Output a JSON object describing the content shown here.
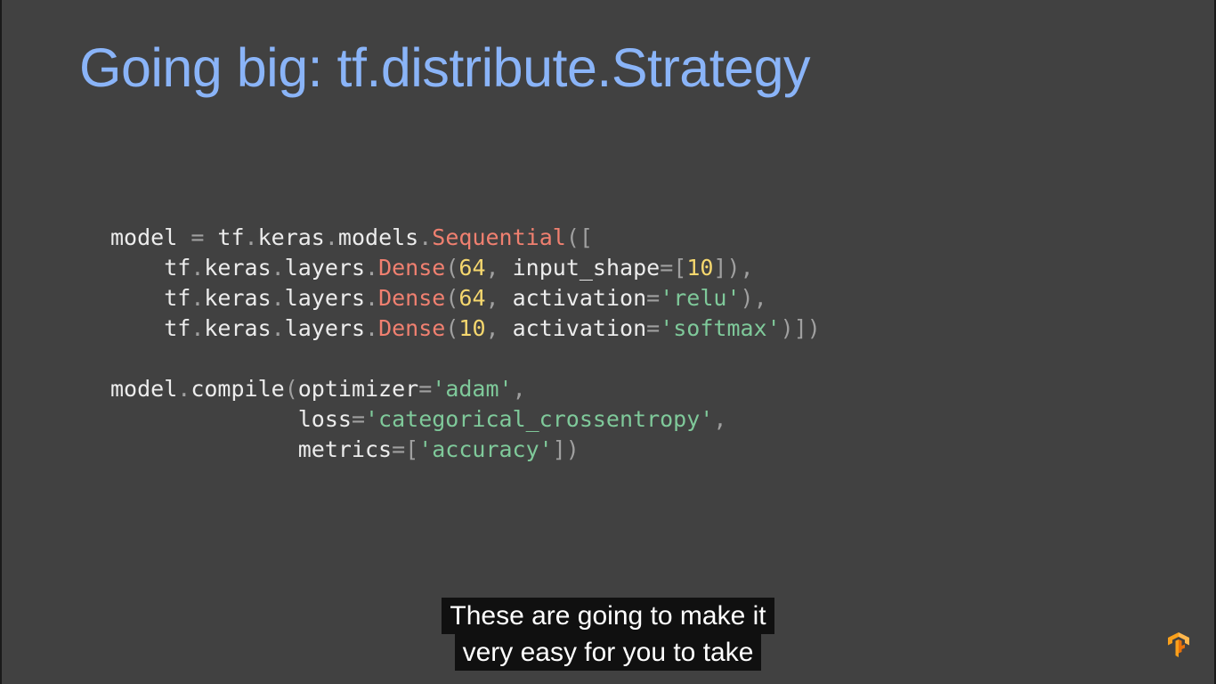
{
  "slide": {
    "title": "Going big: tf.distribute.Strategy",
    "code_lines": [
      [
        {
          "t": "model",
          "c": "plain"
        },
        {
          "t": " = ",
          "c": "punct"
        },
        {
          "t": "tf",
          "c": "plain"
        },
        {
          "t": ".",
          "c": "punct"
        },
        {
          "t": "keras",
          "c": "plain"
        },
        {
          "t": ".",
          "c": "punct"
        },
        {
          "t": "models",
          "c": "plain"
        },
        {
          "t": ".",
          "c": "punct"
        },
        {
          "t": "Sequential",
          "c": "class"
        },
        {
          "t": "([",
          "c": "punct"
        }
      ],
      [
        {
          "t": "    tf",
          "c": "plain"
        },
        {
          "t": ".",
          "c": "punct"
        },
        {
          "t": "keras",
          "c": "plain"
        },
        {
          "t": ".",
          "c": "punct"
        },
        {
          "t": "layers",
          "c": "plain"
        },
        {
          "t": ".",
          "c": "punct"
        },
        {
          "t": "Dense",
          "c": "class"
        },
        {
          "t": "(",
          "c": "punct"
        },
        {
          "t": "64",
          "c": "num"
        },
        {
          "t": ", ",
          "c": "punct"
        },
        {
          "t": "input_shape",
          "c": "key"
        },
        {
          "t": "=[",
          "c": "punct"
        },
        {
          "t": "10",
          "c": "num"
        },
        {
          "t": "]),",
          "c": "punct"
        }
      ],
      [
        {
          "t": "    tf",
          "c": "plain"
        },
        {
          "t": ".",
          "c": "punct"
        },
        {
          "t": "keras",
          "c": "plain"
        },
        {
          "t": ".",
          "c": "punct"
        },
        {
          "t": "layers",
          "c": "plain"
        },
        {
          "t": ".",
          "c": "punct"
        },
        {
          "t": "Dense",
          "c": "class"
        },
        {
          "t": "(",
          "c": "punct"
        },
        {
          "t": "64",
          "c": "num"
        },
        {
          "t": ", ",
          "c": "punct"
        },
        {
          "t": "activation",
          "c": "key"
        },
        {
          "t": "=",
          "c": "punct"
        },
        {
          "t": "'relu'",
          "c": "str"
        },
        {
          "t": "),",
          "c": "punct"
        }
      ],
      [
        {
          "t": "    tf",
          "c": "plain"
        },
        {
          "t": ".",
          "c": "punct"
        },
        {
          "t": "keras",
          "c": "plain"
        },
        {
          "t": ".",
          "c": "punct"
        },
        {
          "t": "layers",
          "c": "plain"
        },
        {
          "t": ".",
          "c": "punct"
        },
        {
          "t": "Dense",
          "c": "class"
        },
        {
          "t": "(",
          "c": "punct"
        },
        {
          "t": "10",
          "c": "num"
        },
        {
          "t": ", ",
          "c": "punct"
        },
        {
          "t": "activation",
          "c": "key"
        },
        {
          "t": "=",
          "c": "punct"
        },
        {
          "t": "'softmax'",
          "c": "str"
        },
        {
          "t": ")])",
          "c": "punct"
        }
      ],
      [],
      [
        {
          "t": "model",
          "c": "plain"
        },
        {
          "t": ".",
          "c": "punct"
        },
        {
          "t": "compile",
          "c": "plain"
        },
        {
          "t": "(",
          "c": "punct"
        },
        {
          "t": "optimizer",
          "c": "key"
        },
        {
          "t": "=",
          "c": "punct"
        },
        {
          "t": "'adam'",
          "c": "str"
        },
        {
          "t": ",",
          "c": "punct"
        }
      ],
      [
        {
          "t": "              loss",
          "c": "key"
        },
        {
          "t": "=",
          "c": "punct"
        },
        {
          "t": "'categorical_crossentropy'",
          "c": "str"
        },
        {
          "t": ",",
          "c": "punct"
        }
      ],
      [
        {
          "t": "              metrics",
          "c": "key"
        },
        {
          "t": "=[",
          "c": "punct"
        },
        {
          "t": "'accuracy'",
          "c": "str"
        },
        {
          "t": "])",
          "c": "punct"
        }
      ]
    ]
  },
  "captions": {
    "line1": "These are going to make it",
    "line2": "very easy for you to take"
  },
  "colors": {
    "background": "#414141",
    "title": "#8ab4f8",
    "class_token": "#f08070",
    "number_token": "#f5d76e",
    "string_token": "#7fc99a",
    "logo_orange": "#f9a01b"
  },
  "icons": {
    "corner_logo": "tensorflow-logo-icon"
  }
}
